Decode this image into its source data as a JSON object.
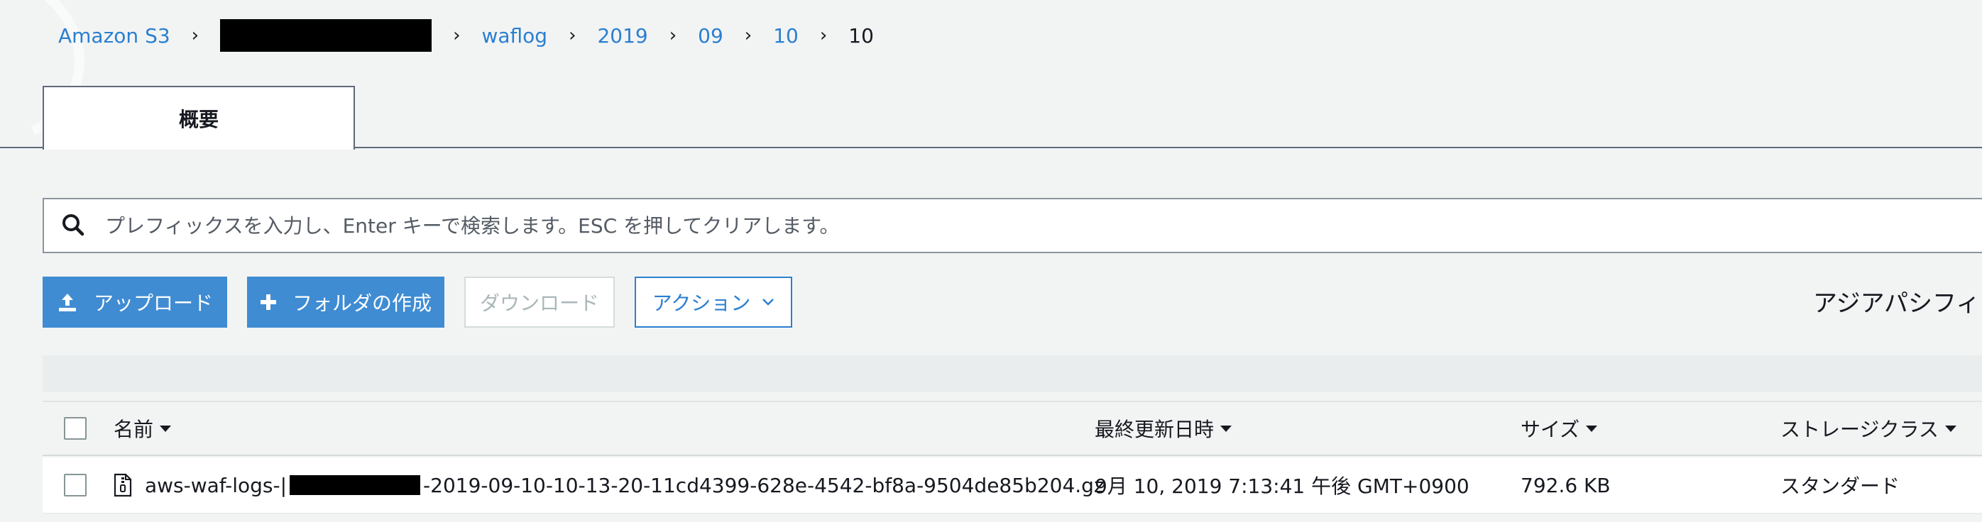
{
  "breadcrumb": {
    "root": "Amazon S3",
    "items": [
      "waflog",
      "2019",
      "09",
      "10"
    ],
    "current": "10"
  },
  "tabs": {
    "overview": "概要"
  },
  "search": {
    "placeholder": "プレフィックスを入力し、Enter キーで検索します。ESC を押してクリアします。"
  },
  "toolbar": {
    "upload": "アップロード",
    "create_folder": "フォルダの作成",
    "download": "ダウンロード",
    "actions": "アクション"
  },
  "region": "アジアパシフィ",
  "table": {
    "headers": {
      "name": "名前",
      "last_modified": "最終更新日時",
      "size": "サイズ",
      "storage_class": "ストレージクラス"
    },
    "rows": [
      {
        "name_prefix": "aws-waf-logs-|",
        "name_suffix": "-2019-09-10-10-13-20-11cd4399-628e-4542-bf8a-9504de85b204.gz",
        "last_modified": "9月 10, 2019 7:13:41 午後 GMT+0900",
        "size": "792.6 KB",
        "storage_class": "スタンダード"
      }
    ]
  },
  "colors": {
    "link": "#2b7fd0",
    "primary_button": "#3f8cd3",
    "page_bg": "#f2f4f4"
  },
  "icons": [
    "search-icon",
    "upload-icon",
    "plus-icon",
    "chevron-down-icon",
    "sort-caret-icon",
    "zip-file-icon",
    "chevron-right-icon"
  ]
}
